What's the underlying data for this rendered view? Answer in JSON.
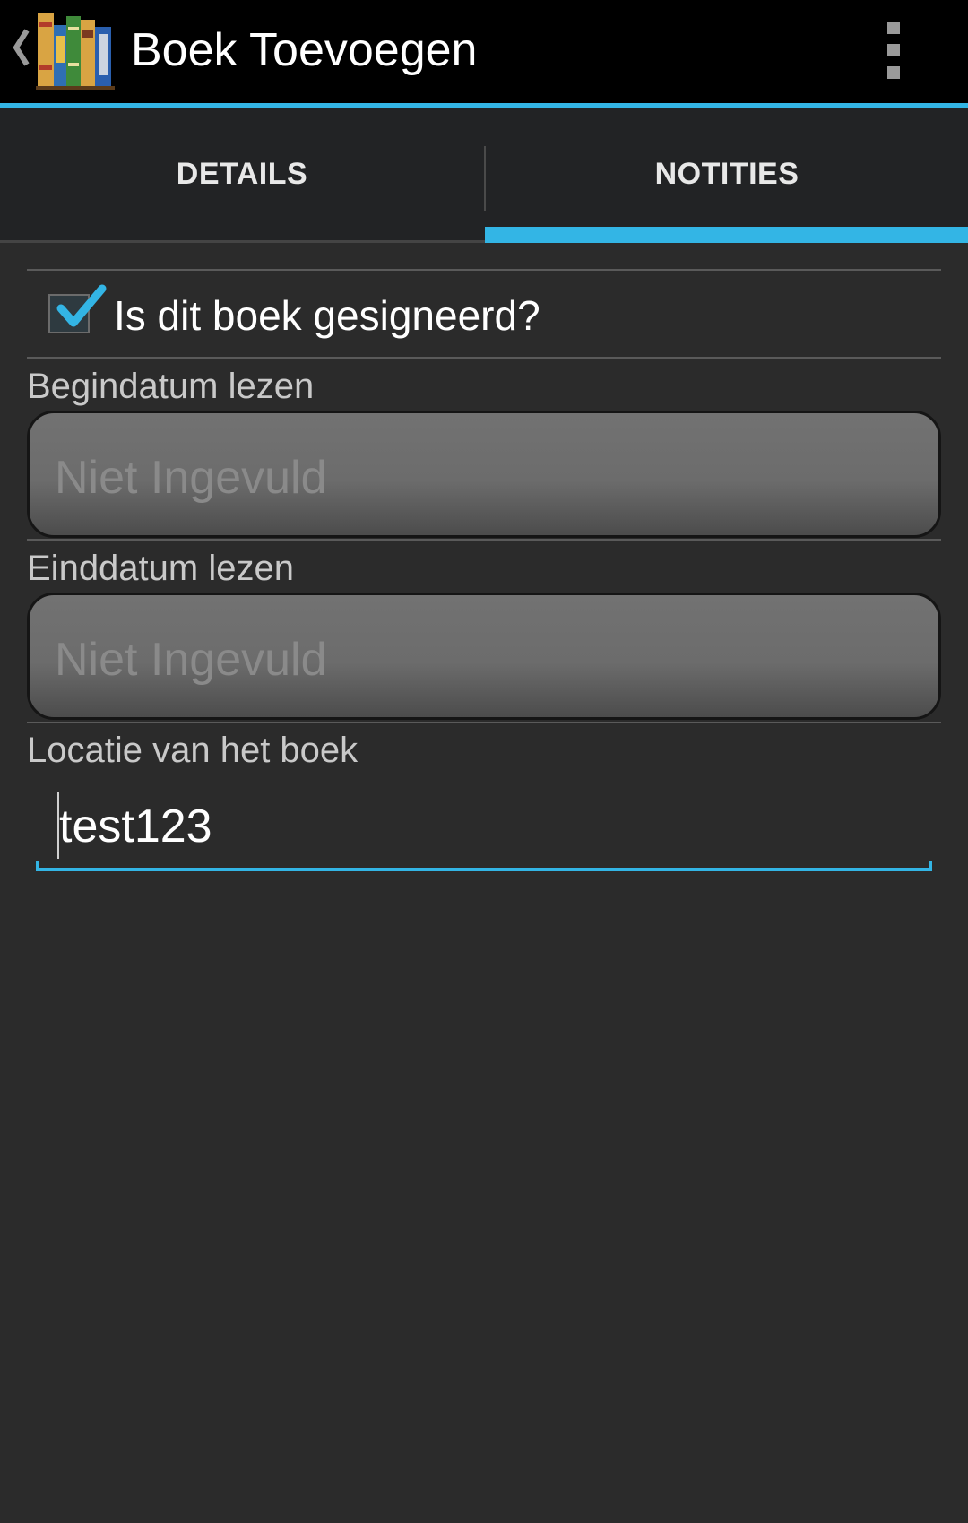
{
  "header": {
    "title": "Boek Toevoegen",
    "accent_color": "#33b5e5"
  },
  "tabs": [
    {
      "label": "DETAILS",
      "selected": false
    },
    {
      "label": "NOTITIES",
      "selected": true
    }
  ],
  "form": {
    "signed": {
      "label": "Is dit boek gesigneerd?",
      "checked": true
    },
    "start_date": {
      "label": "Begindatum lezen",
      "value": "Niet Ingevuld"
    },
    "end_date": {
      "label": "Einddatum lezen",
      "value": "Niet Ingevuld"
    },
    "location": {
      "label": "Locatie van het boek",
      "value": "test123"
    }
  },
  "icons": [
    "up-caret-icon",
    "bookshelf-icon",
    "overflow-menu-icon",
    "checkmark-icon"
  ]
}
